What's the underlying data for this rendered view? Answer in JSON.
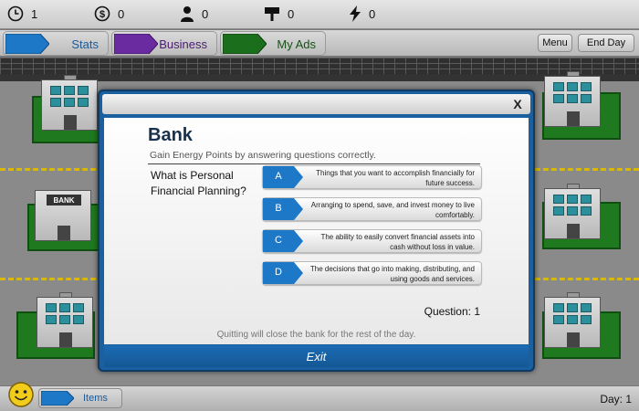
{
  "stats": [
    {
      "icon": "clock-icon",
      "value": "1"
    },
    {
      "icon": "dollar-icon",
      "value": "0"
    },
    {
      "icon": "person-icon",
      "value": "0"
    },
    {
      "icon": "sign-icon",
      "value": "0"
    },
    {
      "icon": "lightning-icon",
      "value": "0"
    }
  ],
  "nav": {
    "tabs": [
      {
        "label": "Stats",
        "color": "#1e78c8",
        "text_color": "#1a5a9a"
      },
      {
        "label": "Business",
        "color": "#6a2aa0",
        "text_color": "#4b1b73"
      },
      {
        "label": "My Ads",
        "color": "#1b6e1b",
        "text_color": "#145214"
      }
    ],
    "menu_label": "Menu",
    "end_day_label": "End Day"
  },
  "map": {
    "bank_sign": "BANK"
  },
  "bottom": {
    "items_label": "Items",
    "day_label": "Day: 1"
  },
  "modal": {
    "close_label": "X",
    "title": "Bank",
    "subtitle": "Gain Energy Points by answering questions correctly.",
    "question": "What is Personal Financial Planning?",
    "answers": [
      {
        "letter": "A",
        "text": "Things that you want to accomplish financially for future success."
      },
      {
        "letter": "B",
        "text": "Arranging to spend, save, and invest money to live comfortably."
      },
      {
        "letter": "C",
        "text": "The ability to easily convert financial assets into cash without loss in value."
      },
      {
        "letter": "D",
        "text": "The decisions that go into making, distributing, and using goods and services."
      }
    ],
    "question_number": "Question: 1",
    "quit_note": "Quitting will close the bank for the rest of the day.",
    "exit_label": "Exit"
  },
  "colors": {
    "modal_blue": "#1a5f9e",
    "answer_tag_blue": "#1e78c8",
    "grass_green": "#1f7a1f",
    "road_yellow": "#d8b800"
  }
}
